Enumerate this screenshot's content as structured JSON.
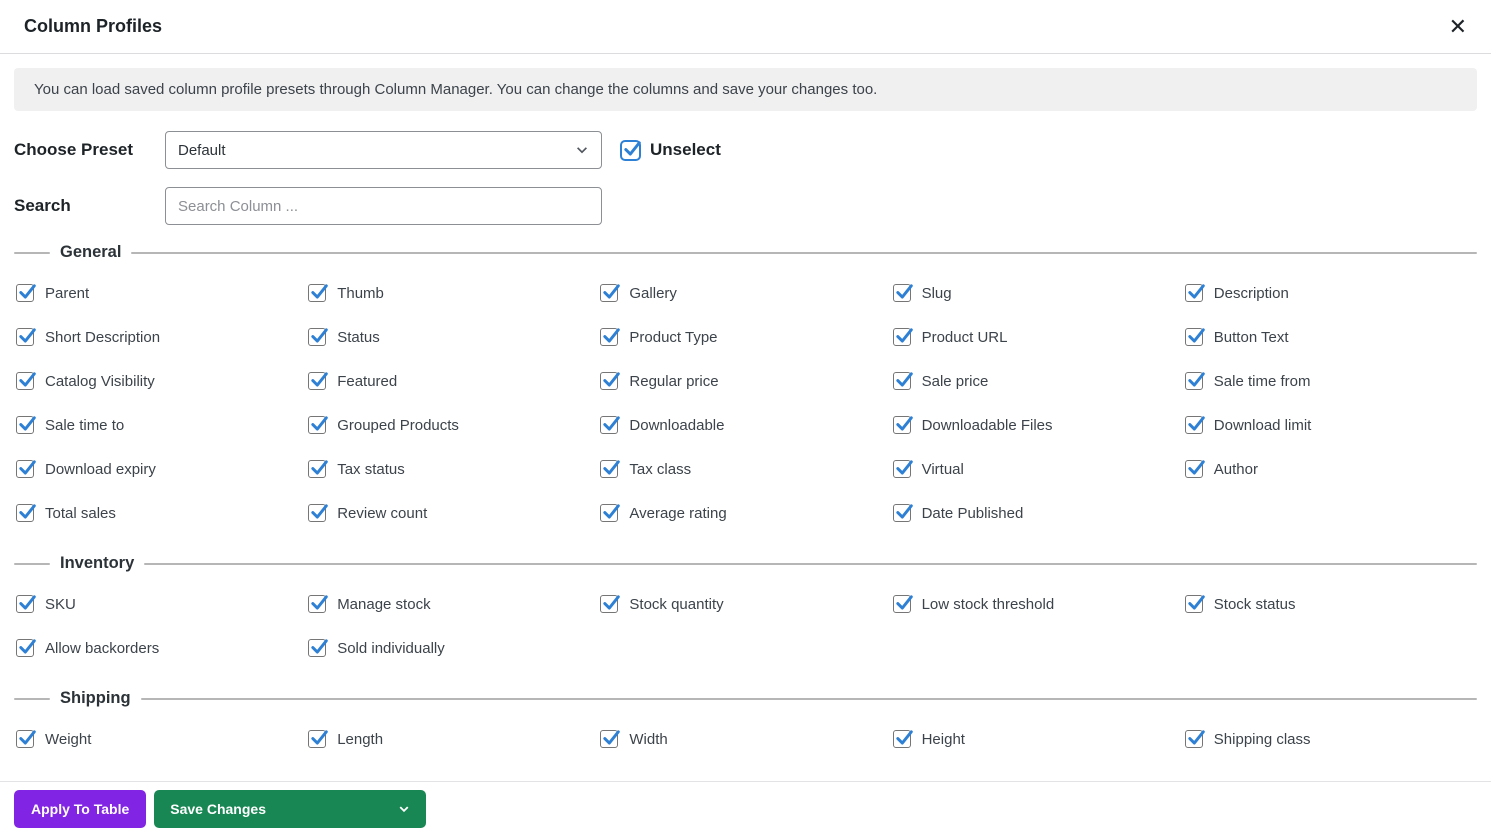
{
  "header": {
    "title": "Column Profiles",
    "close_icon": "✕"
  },
  "info": {
    "message": "You can load saved column profile presets through Column Manager. You can change the columns and save your changes too."
  },
  "preset": {
    "label": "Choose Preset",
    "selected": "Default",
    "unselect_label": "Unselect",
    "unselect_checked": true
  },
  "search": {
    "label": "Search",
    "placeholder": "Search Column ..."
  },
  "sections": [
    {
      "title": "General",
      "checked": true,
      "items": [
        "Parent",
        "Thumb",
        "Gallery",
        "Slug",
        "Description",
        "Short Description",
        "Status",
        "Product Type",
        "Product URL",
        "Button Text",
        "Catalog Visibility",
        "Featured",
        "Regular price",
        "Sale price",
        "Sale time from",
        "Sale time to",
        "Grouped Products",
        "Downloadable",
        "Downloadable Files",
        "Download limit",
        "Download expiry",
        "Tax status",
        "Tax class",
        "Virtual",
        "Author",
        "Total sales",
        "Review count",
        "Average rating",
        "Date Published"
      ]
    },
    {
      "title": "Inventory",
      "checked": true,
      "items": [
        "SKU",
        "Manage stock",
        "Stock quantity",
        "Low stock threshold",
        "Stock status",
        "Allow backorders",
        "Sold individually"
      ]
    },
    {
      "title": "Shipping",
      "checked": true,
      "items": [
        "Weight",
        "Length",
        "Width",
        "Height",
        "Shipping class"
      ]
    }
  ],
  "footer": {
    "apply_button": "Apply To Table",
    "save_button": "Save Changes"
  },
  "colors": {
    "checkbox_check_blue": "#2e80d4",
    "unselect_blue": "#2271b1",
    "apply_button_purple": "#8224e3",
    "save_button_green": "#198754"
  }
}
